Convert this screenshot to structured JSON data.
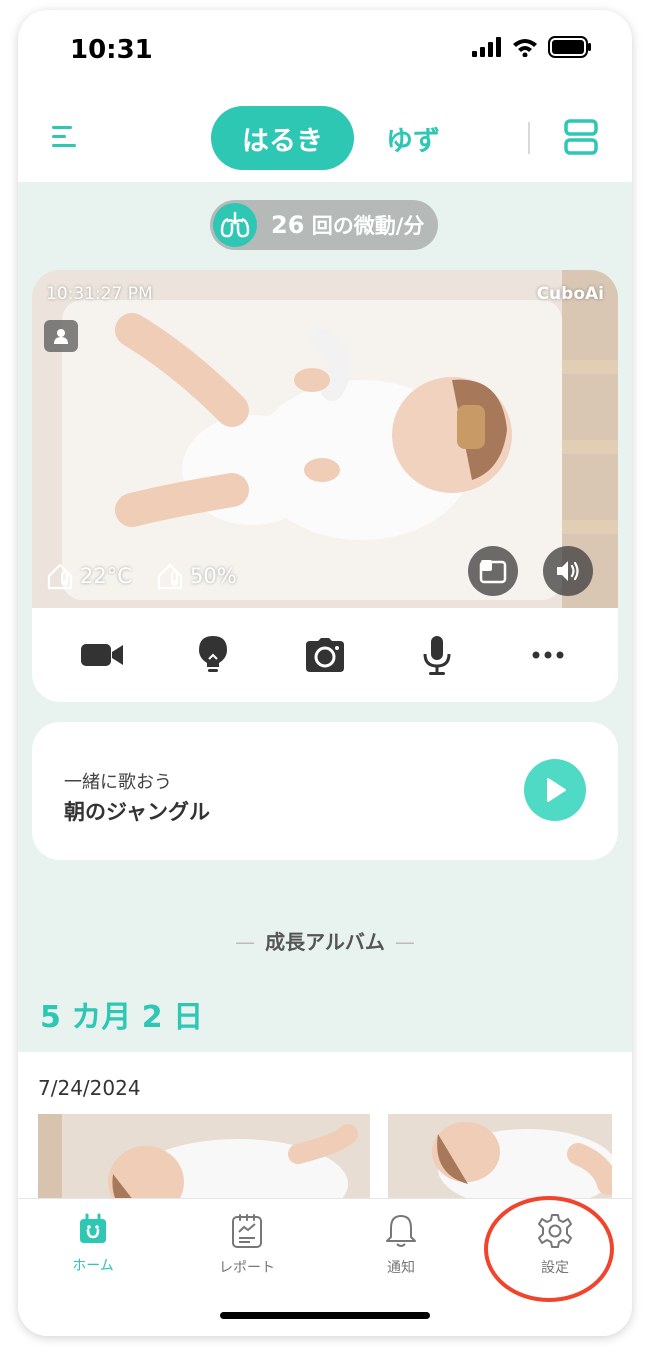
{
  "status_bar": {
    "time": "10:31"
  },
  "header": {
    "tabs": [
      {
        "label": "はるき",
        "active": true
      },
      {
        "label": "ゆず",
        "active": false
      }
    ]
  },
  "breathing": {
    "count": "26",
    "unit": "回の微動/分"
  },
  "camera": {
    "timestamp": "10:31:27 PM",
    "brand": "CuboAi",
    "temperature": "22°C",
    "humidity": "50%"
  },
  "song": {
    "subtitle": "一緒に歌おう",
    "title": "朝のジャングル"
  },
  "album": {
    "heading": "成長アルバム",
    "age": "5 カ月 2 日",
    "date": "7/24/2024"
  },
  "tabbar": {
    "items": [
      {
        "label": "ホーム",
        "active": true
      },
      {
        "label": "レポート",
        "active": false
      },
      {
        "label": "通知",
        "active": false
      },
      {
        "label": "設定",
        "active": false
      }
    ]
  },
  "colors": {
    "accent": "#2dc7b3",
    "play": "#4fdac5",
    "background": "#e8f3f0",
    "highlight": "#f0442c"
  }
}
